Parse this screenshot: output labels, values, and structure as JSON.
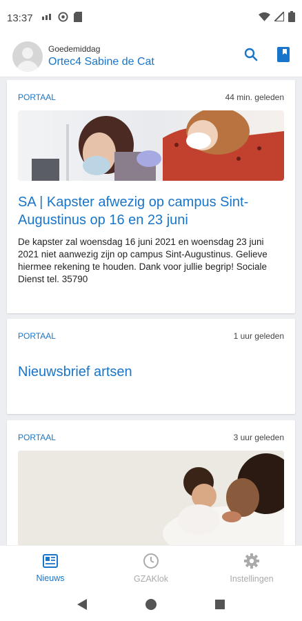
{
  "status_bar": {
    "time": "13:37",
    "icons": [
      "signal-mini-icon",
      "whatsapp-icon",
      "sd-card-icon"
    ],
    "right_icons": [
      "wifi-icon",
      "cell-signal-icon",
      "battery-icon"
    ]
  },
  "header": {
    "greeting": "Goedemiddag",
    "user_name": "Ortec4 Sabine de Cat",
    "actions": [
      "search-icon",
      "bookmark-icon"
    ]
  },
  "feed": {
    "items": [
      {
        "category": "PORTAAL",
        "timestamp": "44 min. geleden",
        "title": "SA | Kapster afwezig op campus Sint-Augustinus op 16 en 23 juni",
        "body": "De kapster zal woensdag 16 juni 2021 en woensdag 23 juni 2021 niet aanwezig zijn op campus Sint-Augustinus. Gelieve hiermee rekening te houden.  Dank voor jullie begrip!  Sociale Dienst  tel. 35790"
      },
      {
        "category": "PORTAAL",
        "timestamp": "1 uur geleden",
        "title": "Nieuwsbrief artsen"
      },
      {
        "category": "PORTAAL",
        "timestamp": "3 uur geleden"
      }
    ]
  },
  "bottom_nav": {
    "items": [
      {
        "label": "Nieuws",
        "icon": "news-icon",
        "active": true
      },
      {
        "label": "GZAKlok",
        "icon": "clock-icon",
        "active": false
      },
      {
        "label": "Instellingen",
        "icon": "gear-icon",
        "active": false
      }
    ]
  },
  "system_nav": [
    "back-icon",
    "home-icon",
    "recents-icon"
  ],
  "colors": {
    "accent": "#1875c9",
    "inactive": "#aaaaaa",
    "background": "#eceef1"
  }
}
